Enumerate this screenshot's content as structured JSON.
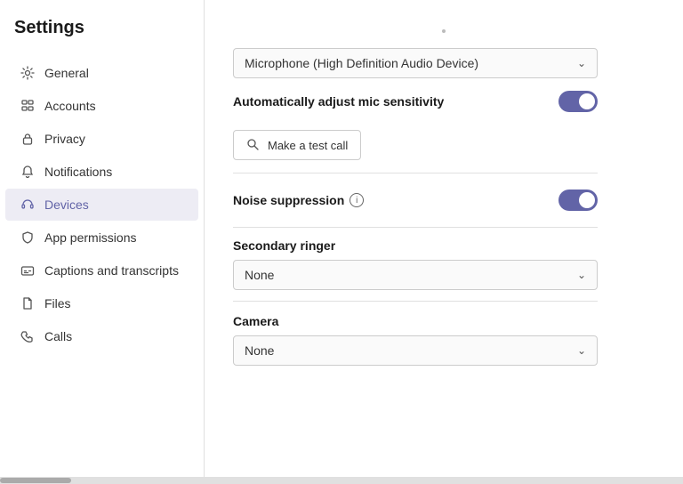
{
  "sidebar": {
    "title": "Settings",
    "items": [
      {
        "id": "general",
        "label": "General",
        "icon": "gear"
      },
      {
        "id": "accounts",
        "label": "Accounts",
        "icon": "accounts"
      },
      {
        "id": "privacy",
        "label": "Privacy",
        "icon": "lock"
      },
      {
        "id": "notifications",
        "label": "Notifications",
        "icon": "bell"
      },
      {
        "id": "devices",
        "label": "Devices",
        "icon": "headset",
        "active": true
      },
      {
        "id": "app-permissions",
        "label": "App permissions",
        "icon": "shield"
      },
      {
        "id": "captions",
        "label": "Captions and transcripts",
        "icon": "cc"
      },
      {
        "id": "files",
        "label": "Files",
        "icon": "file"
      },
      {
        "id": "calls",
        "label": "Calls",
        "icon": "phone"
      }
    ]
  },
  "main": {
    "microphone_label": "Microphone (High Definition Audio Device)",
    "auto_mic_label": "Automatically adjust mic sensitivity",
    "test_call_label": "Make a test call",
    "noise_suppression_label": "Noise suppression",
    "secondary_ringer_label": "Secondary ringer",
    "secondary_ringer_value": "None",
    "camera_label": "Camera",
    "camera_value": "None"
  },
  "colors": {
    "accent": "#6264a7",
    "active_bg": "#edecf4"
  }
}
